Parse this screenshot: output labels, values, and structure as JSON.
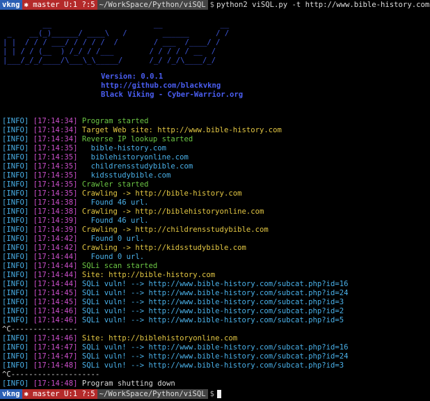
{
  "prompt_top": {
    "user": "vkng",
    "git_icon": "git-branch-icon",
    "git": "master U:1 ?:5",
    "path": "~/WorkSpace/Python/viSQL",
    "symbol": "$",
    "command": "python2 viSQL.py -t http://www.bible-history.com"
  },
  "banner": {
    "art": [
      "         __                       __             __",
      " _    __(_)______/ ____\\   /        ______      / /",
      "| |  / / / ___/ / / / /  /        / ___  /____/ /",
      "| | / / (__  ) /_/ / /___        / / / / / __  / ",
      "|___/_/_/____/\\___\\_\\_____/      /_/ /_/\\____/_/  "
    ],
    "version": "Version: 0.0.1",
    "github": "http://github.com/blackvkng",
    "author": "Black Viking - Cyber-Warrior.org"
  },
  "log": [
    {
      "tag": "[INFO]",
      "ts": "[17:14:34]",
      "msg": "Program started",
      "color": "green"
    },
    {
      "tag": "[INFO]",
      "ts": "[17:14:34]",
      "msg": "Target Web site: http://www.bible-history.com",
      "color": "yellow"
    },
    {
      "tag": "[INFO]",
      "ts": "[17:14:34]",
      "msg": "Reverse IP lookup started",
      "color": "green"
    },
    {
      "tag": "[INFO]",
      "ts": "[17:14:35]",
      "msg": "  bible-history.com",
      "color": "cyan"
    },
    {
      "tag": "[INFO]",
      "ts": "[17:14:35]",
      "msg": "  biblehistoryonline.com",
      "color": "cyan"
    },
    {
      "tag": "[INFO]",
      "ts": "[17:14:35]",
      "msg": "  childrensstudybible.com",
      "color": "cyan"
    },
    {
      "tag": "[INFO]",
      "ts": "[17:14:35]",
      "msg": "  kidsstudybible.com",
      "color": "cyan"
    },
    {
      "tag": "[INFO]",
      "ts": "[17:14:35]",
      "msg": "Crawler started",
      "color": "green"
    },
    {
      "tag": "[INFO]",
      "ts": "[17:14:35]",
      "msg": "Crawling -> http://bible-history.com",
      "color": "yellow"
    },
    {
      "tag": "[INFO]",
      "ts": "[17:14:38]",
      "msg": "  Found 46 url.",
      "color": "cyan"
    },
    {
      "tag": "[INFO]",
      "ts": "[17:14:38]",
      "msg": "Crawling -> http://biblehistoryonline.com",
      "color": "yellow"
    },
    {
      "tag": "[INFO]",
      "ts": "[17:14:39]",
      "msg": "  Found 46 url.",
      "color": "cyan"
    },
    {
      "tag": "[INFO]",
      "ts": "[17:14:39]",
      "msg": "Crawling -> http://childrensstudybible.com",
      "color": "yellow"
    },
    {
      "tag": "[INFO]",
      "ts": "[17:14:42]",
      "msg": "  Found 0 url.",
      "color": "cyan"
    },
    {
      "tag": "[INFO]",
      "ts": "[17:14:42]",
      "msg": "Crawling -> http://kidsstudybible.com",
      "color": "yellow"
    },
    {
      "tag": "[INFO]",
      "ts": "[17:14:44]",
      "msg": "  Found 0 url.",
      "color": "cyan"
    },
    {
      "tag": "[INFO]",
      "ts": "[17:14:44]",
      "msg": "SQLi scan started",
      "color": "green"
    },
    {
      "tag": "[INFO]",
      "ts": "[17:14:44]",
      "msg": "Site: http://bible-history.com",
      "color": "yellow"
    },
    {
      "tag": "[INFO]",
      "ts": "[17:14:44]",
      "msg": "SQLi vuln! --> http://www.bible-history.com/subcat.php?id=16",
      "color": "cyan"
    },
    {
      "tag": "[INFO]",
      "ts": "[17:14:45]",
      "msg": "SQLi vuln! --> http://www.bible-history.com/subcat.php?id=24",
      "color": "cyan"
    },
    {
      "tag": "[INFO]",
      "ts": "[17:14:45]",
      "msg": "SQLi vuln! --> http://www.bible-history.com/subcat.php?id=3",
      "color": "cyan"
    },
    {
      "tag": "[INFO]",
      "ts": "[17:14:46]",
      "msg": "SQLi vuln! --> http://www.bible-history.com/subcat.php?id=2",
      "color": "cyan"
    },
    {
      "tag": "[INFO]",
      "ts": "[17:14:46]",
      "msg": "SQLi vuln! --> http://www.bible-history.com/subcat.php?id=5",
      "color": "cyan"
    },
    {
      "tag": "",
      "ts": "",
      "msg": "^C---------------",
      "color": "white"
    },
    {
      "tag": "[INFO]",
      "ts": "[17:14:46]",
      "msg": "Site: http://biblehistoryonline.com",
      "color": "yellow"
    },
    {
      "tag": "[INFO]",
      "ts": "[17:14:47]",
      "msg": "SQLi vuln! --> http://www.bible-history.com/subcat.php?id=16",
      "color": "cyan"
    },
    {
      "tag": "[INFO]",
      "ts": "[17:14:47]",
      "msg": "SQLi vuln! --> http://www.bible-history.com/subcat.php?id=24",
      "color": "cyan"
    },
    {
      "tag": "[INFO]",
      "ts": "[17:14:48]",
      "msg": "SQLi vuln! --> http://www.bible-history.com/subcat.php?id=3",
      "color": "cyan"
    },
    {
      "tag": "",
      "ts": "",
      "msg": "^C--------------------",
      "color": "white"
    },
    {
      "tag": "[INFO]",
      "ts": "[17:14:48]",
      "msg": "Program shutting down",
      "color": "white"
    }
  ],
  "prompt_bottom": {
    "user": "vkng",
    "git_icon": "git-branch-icon",
    "git": "master U:1 ?:5",
    "path": "~/WorkSpace/Python/viSQL",
    "symbol": "$"
  },
  "colors": {
    "tag": "#4ab0e8",
    "timestamp": "#c94fc9",
    "green": "#6cc644",
    "yellow": "#e2c643",
    "banner": "#3d56d8"
  }
}
